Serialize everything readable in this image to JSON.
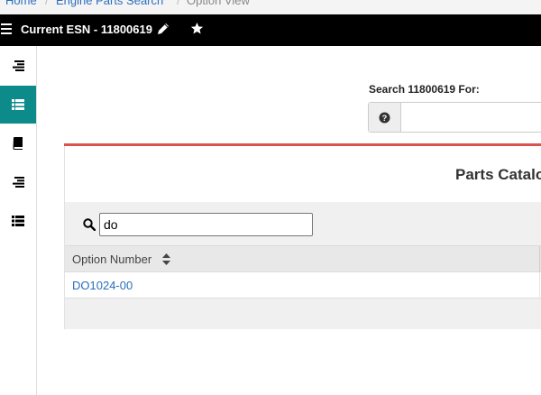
{
  "breadcrumb": {
    "home": "Home",
    "engine_parts_search": "Engine Parts Search",
    "option_view": "Option View"
  },
  "topbar": {
    "title": "Current ESN - 11800619",
    "menu_icon": "hamburger-icon",
    "edit_icon": "pencil-icon",
    "favorite_icon": "star-icon"
  },
  "sidebar": {
    "items": [
      {
        "icon": "align-right-icon",
        "active": false
      },
      {
        "icon": "list-icon",
        "active": true
      },
      {
        "icon": "book-icon",
        "active": false
      },
      {
        "icon": "align-right-icon",
        "active": false
      },
      {
        "icon": "list-icon",
        "active": false
      }
    ],
    "active_color": "#0d8a8a"
  },
  "search": {
    "label": "Search 11800619 For:",
    "help_icon": "question-circle-icon",
    "value": ""
  },
  "panel": {
    "title": "Parts Catalog",
    "filter": {
      "icon": "search-icon",
      "value": "do"
    },
    "table": {
      "columns": [
        "Option Number"
      ],
      "rows": [
        {
          "option_number": "DO1024-00"
        }
      ]
    }
  },
  "colors": {
    "accent": "#d9534f",
    "link": "#2a6ebb",
    "topbar": "#000000"
  }
}
